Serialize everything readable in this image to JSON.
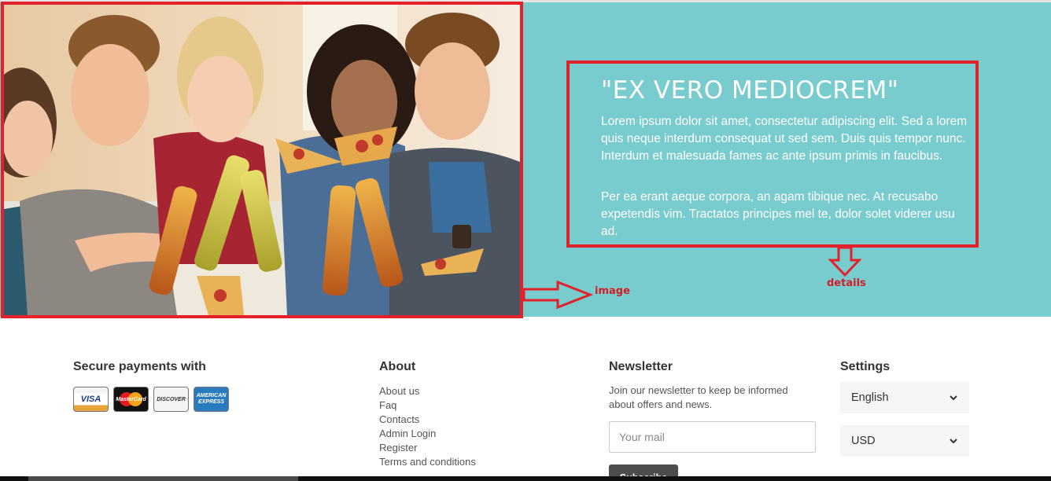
{
  "hero": {
    "details": {
      "title": "\"EX VERO MEDIOCREM\"",
      "paragraph1": "Lorem ipsum dolor sit amet, consectetur adipiscing elit. Sed a lorem quis neque interdum consequat ut sed sem. Duis quis tempor nunc. Interdum et malesuada fames ac ante ipsum primis in faucibus.",
      "paragraph2": "Per ea erant aeque corpora, an agam tibique nec. At recusabo expetendis vim. Tractatos principes mel te, dolor solet viderer usu ad."
    },
    "annotations": {
      "image_label": "image",
      "details_label": "details",
      "color": "#d11f28"
    },
    "background_color": "#78cccd",
    "highlight_color": "#e3212b"
  },
  "footer": {
    "payments": {
      "heading": "Secure payments with",
      "cards": [
        {
          "name": "visa",
          "label": "VISA"
        },
        {
          "name": "mastercard",
          "label": "MasterCard"
        },
        {
          "name": "discover",
          "label": "DISCOVER"
        },
        {
          "name": "amex",
          "label": "AMERICAN EXPRESS"
        }
      ]
    },
    "about": {
      "heading": "About",
      "links": [
        "About us",
        "Faq",
        "Contacts",
        "Admin Login",
        "Register",
        "Terms and conditions"
      ]
    },
    "newsletter": {
      "heading": "Newsletter",
      "description": "Join our newsletter to keep be informed about offers and news.",
      "email_placeholder": "Your mail",
      "subscribe_label": "Subscribe"
    },
    "settings": {
      "heading": "Settings",
      "language": "English",
      "currency": "USD"
    }
  }
}
